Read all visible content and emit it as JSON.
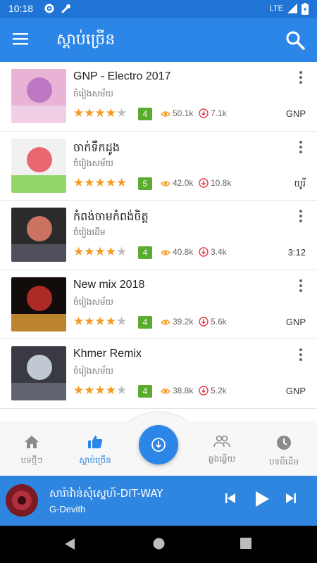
{
  "status_bar": {
    "time": "10:18",
    "network": "LTE"
  },
  "app_bar": {
    "title": "ស្តាប់ច្រើន"
  },
  "songs": [
    {
      "title": "GNP - Electro 2017",
      "subtitle": "ចំរៀងសម័យ",
      "stars": 4,
      "rating": "4",
      "views": "50.1k",
      "downloads": "7.1k",
      "tag": "GNP",
      "thumb_colors": [
        "#e9b3d6",
        "#b56cc0",
        "#f3d7e9"
      ]
    },
    {
      "title": "ចាក់ទឹកដូង",
      "subtitle": "ចំរៀងសម័យ",
      "stars": 5,
      "rating": "5",
      "views": "42.0k",
      "downloads": "10.8k",
      "tag": "យូរី",
      "thumb_colors": [
        "#f1f1f1",
        "#e94d5a",
        "#7ad04a"
      ]
    },
    {
      "title": "កំពង់ចាមកំពង់ចិត្ត",
      "subtitle": "ចំរៀងដើម",
      "stars": 4,
      "rating": "4",
      "views": "40.8k",
      "downloads": "3.4k",
      "tag": "3:12",
      "thumb_colors": [
        "#2b2b2b",
        "#e97f6a",
        "#5a5a6a"
      ]
    },
    {
      "title": "New mix 2018",
      "subtitle": "ចំរៀងសម័យ",
      "stars": 4,
      "rating": "4",
      "views": "39.2k",
      "downloads": "5.6k",
      "tag": "GNP",
      "thumb_colors": [
        "#120c0a",
        "#c9302c",
        "#e9a23a"
      ]
    },
    {
      "title": "Khmer Remix",
      "subtitle": "ចំរៀងសម័យ",
      "stars": 4,
      "rating": "4",
      "views": "38.8k",
      "downloads": "5.2k",
      "tag": "GNP",
      "thumb_colors": [
        "#3a3a44",
        "#d8e3ea",
        "#6b6f7a"
      ]
    }
  ],
  "bottom_nav": {
    "items": [
      {
        "label": "បទថ្មីៗ",
        "icon": "home-icon",
        "active": false
      },
      {
        "label": "ស្តាប់ច្រើន",
        "icon": "thumbs-up-icon",
        "active": true
      },
      {
        "label": "ឆ្លងឆ្លើយ",
        "icon": "people-icon",
        "active": false
      },
      {
        "label": "បទពីដើម",
        "icon": "clock-icon",
        "active": false
      }
    ],
    "fab_icon": "download-icon"
  },
  "player": {
    "song": "សារ៉ាវ៉ាន់សុំស្នេហ៍-DIT-WAY",
    "artist": "G-Devith"
  },
  "colors": {
    "primary": "#2b86e8",
    "status": "#1f74d6",
    "star": "#f59a23",
    "rating_badge": "#5aac2e",
    "download": "#e33b4b"
  }
}
